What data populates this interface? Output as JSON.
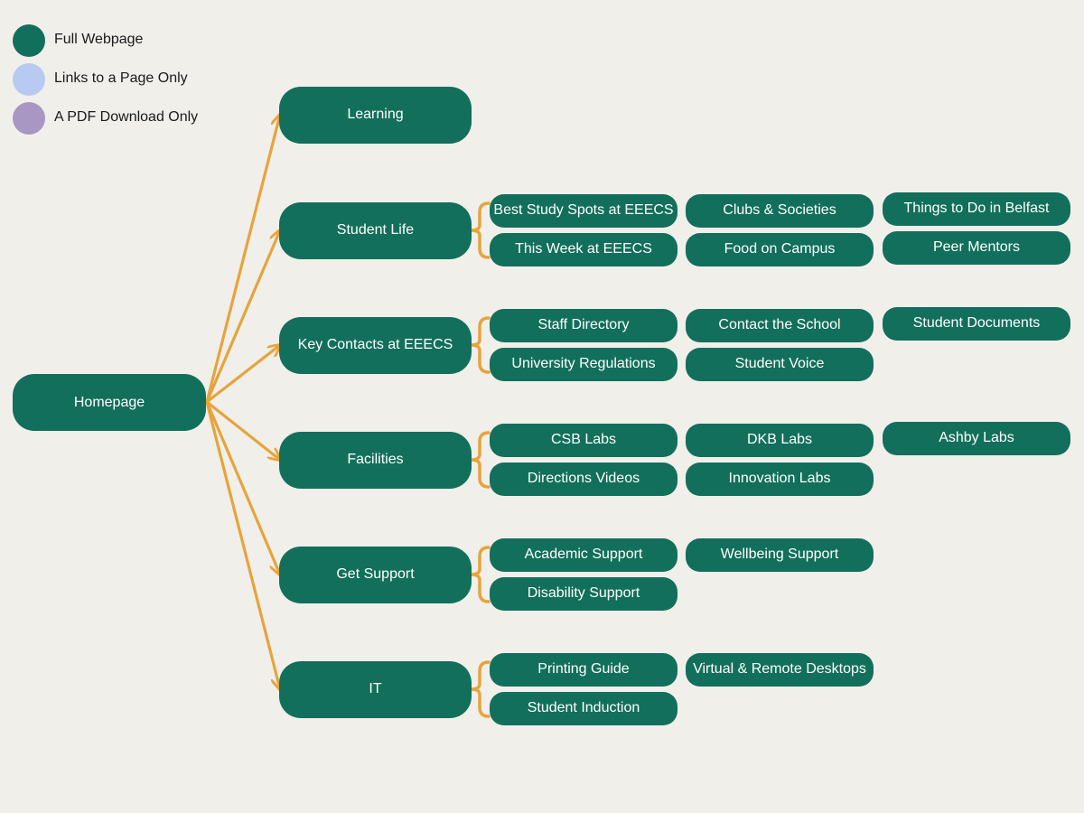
{
  "colors": {
    "full_webpage": "#126f5b",
    "links_only": "#b8c9f2",
    "pdf_only": "#a897c2",
    "connector": "#e6a43c",
    "background": "#f0efea"
  },
  "legend": [
    {
      "label": "Full Webpage",
      "color_key": "full_webpage"
    },
    {
      "label": "Links to a Page Only",
      "color_key": "links_only"
    },
    {
      "label": "A PDF Download Only",
      "color_key": "pdf_only"
    }
  ],
  "root": {
    "label": "Homepage",
    "kind": "full_webpage"
  },
  "sections": [
    {
      "label": "Learning",
      "kind": "full_webpage",
      "children": []
    },
    {
      "label": "Student Life",
      "kind": "full_webpage",
      "children": [
        {
          "label": "Best Study Spots at EEECS",
          "kind": "full_webpage"
        },
        {
          "label": "This Week at EEECS",
          "kind": "full_webpage"
        },
        {
          "label": "Clubs & Societies",
          "kind": "full_webpage"
        },
        {
          "label": "Food on Campus",
          "kind": "full_webpage"
        },
        {
          "label": "Things to Do in Belfast",
          "kind": "full_webpage"
        },
        {
          "label": "Peer Mentors",
          "kind": "full_webpage"
        }
      ]
    },
    {
      "label": "Key Contacts at EEECS",
      "kind": "full_webpage",
      "children": [
        {
          "label": "Staff Directory",
          "kind": "full_webpage"
        },
        {
          "label": "University Regulations",
          "kind": "full_webpage"
        },
        {
          "label": "Contact the School",
          "kind": "full_webpage"
        },
        {
          "label": "Student Voice",
          "kind": "full_webpage"
        },
        {
          "label": "Student Documents",
          "kind": "full_webpage"
        }
      ]
    },
    {
      "label": "Facilities",
      "kind": "full_webpage",
      "children": [
        {
          "label": "CSB Labs",
          "kind": "full_webpage"
        },
        {
          "label": "Directions Videos",
          "kind": "full_webpage"
        },
        {
          "label": "DKB Labs",
          "kind": "full_webpage"
        },
        {
          "label": "Innovation Labs",
          "kind": "full_webpage"
        },
        {
          "label": "Ashby Labs",
          "kind": "full_webpage"
        }
      ]
    },
    {
      "label": "Get Support",
      "kind": "full_webpage",
      "children": [
        {
          "label": "Academic Support",
          "kind": "full_webpage"
        },
        {
          "label": "Disability Support",
          "kind": "full_webpage"
        },
        {
          "label": "Wellbeing Support",
          "kind": "full_webpage"
        }
      ]
    },
    {
      "label": "IT",
      "kind": "full_webpage",
      "children": [
        {
          "label": "Printing Guide",
          "kind": "full_webpage"
        },
        {
          "label": "Student Induction",
          "kind": "full_webpage"
        },
        {
          "label": "Virtual & Remote Desktops",
          "kind": "full_webpage"
        }
      ]
    }
  ]
}
